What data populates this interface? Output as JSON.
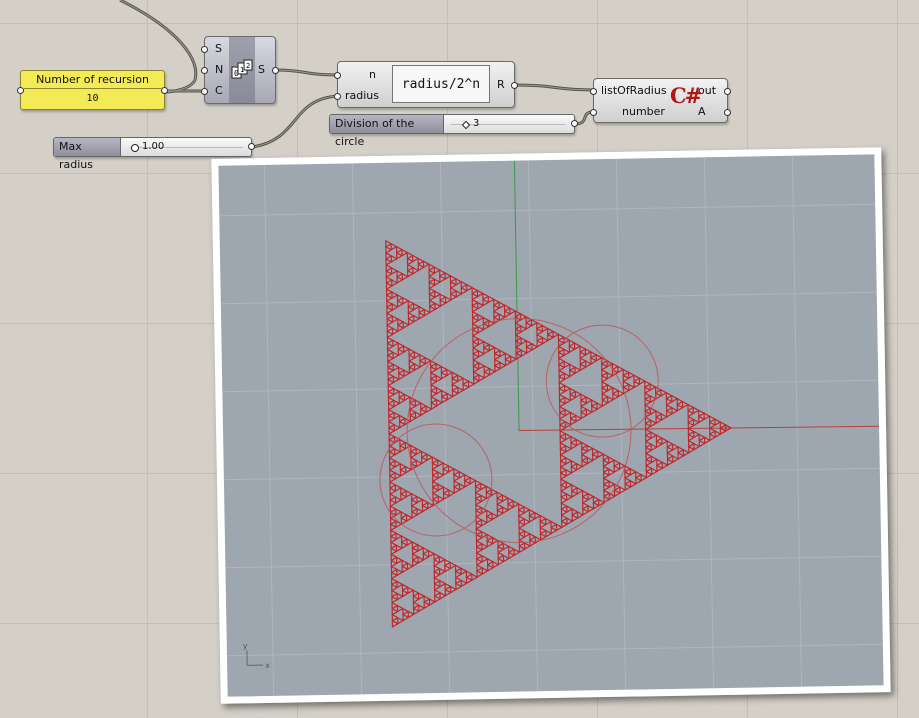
{
  "panel": {
    "title": "Number of recursion",
    "value": "10"
  },
  "series": {
    "inputs": [
      "S",
      "N",
      "C"
    ],
    "output": "S",
    "icon": "series-icon"
  },
  "expression": {
    "inputs": [
      "n",
      "radius"
    ],
    "code": "radius/2^n",
    "output": "R"
  },
  "csharp": {
    "inputs": [
      "listOfRadius",
      "number"
    ],
    "outputs": [
      "out",
      "A"
    ],
    "logo": "C#"
  },
  "sliders": {
    "division": {
      "label": "Division of the circle",
      "value": "3"
    },
    "max_radius": {
      "label": "Max radius",
      "value": "1.00"
    }
  },
  "viewport": {
    "axis_y": "y",
    "axis_x": "x",
    "recursion_depth": 6
  },
  "colors": {
    "canvas": "#d4d0c8",
    "wire": "#4a4a42",
    "fractal": "#c0282c",
    "viewport_bg": "#9ea6b0",
    "panel": "#f3ea55"
  }
}
